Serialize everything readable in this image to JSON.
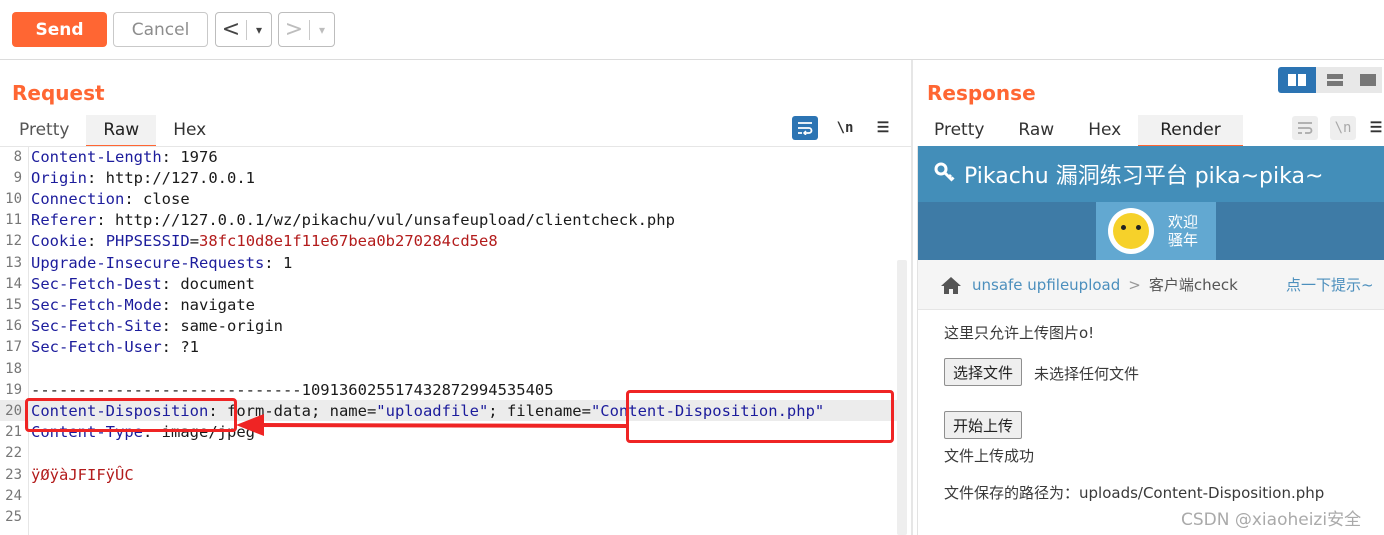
{
  "toolbar": {
    "send_label": "Send",
    "cancel_label": "Cancel",
    "back_arrow": "<",
    "forward_arrow": ">",
    "dropdown_glyph": "▾"
  },
  "request": {
    "title": "Request",
    "tabs": [
      "Pretty",
      "Raw",
      "Hex"
    ],
    "active_tab": "Raw",
    "tool_wrap_icon": "wrap-lines-icon",
    "tool_newline_label": "\\n",
    "tool_menu_glyph": "☰",
    "lines": [
      {
        "n": "8",
        "key": "Content-Length",
        "val": " 1976"
      },
      {
        "n": "9",
        "key": "Origin",
        "val": " http://127.0.0.1"
      },
      {
        "n": "10",
        "key": "Connection",
        "val": " close"
      },
      {
        "n": "11",
        "key": "Referer",
        "val": " http://127.0.0.1/wz/pikachu/vul/unsafeupload/clientcheck.php"
      },
      {
        "n": "12",
        "key": "Cookie",
        "val": " ",
        "cookie_name": "PHPSESSID",
        "cookie_eq": "=",
        "cookie_val": "38fc10d8e1f11e67bea0b270284cd5e8"
      },
      {
        "n": "13",
        "key": "Upgrade-Insecure-Requests",
        "val": " 1"
      },
      {
        "n": "14",
        "key": "Sec-Fetch-Dest",
        "val": " document"
      },
      {
        "n": "15",
        "key": "Sec-Fetch-Mode",
        "val": " navigate"
      },
      {
        "n": "16",
        "key": "Sec-Fetch-Site",
        "val": " same-origin"
      },
      {
        "n": "17",
        "key": "Sec-Fetch-User",
        "val": " ?1"
      },
      {
        "n": "18",
        "key": "",
        "val": ""
      },
      {
        "n": "19",
        "key": "",
        "val": "-----------------------------109136025517432872994535405"
      },
      {
        "n": "20",
        "key": "Content-Disposition",
        "val": " form-data; name=",
        "q1": "\"uploadfile\"",
        "mid": "; filename=",
        "q2": "\"Content-Disposition.php\""
      },
      {
        "n": "21",
        "key": "Content-Type",
        "val": " image/jpeg"
      },
      {
        "n": "22",
        "key": "",
        "val": ""
      },
      {
        "n": "23",
        "key": "",
        "val": "",
        "binary": "ÿØÿàJFIFÿÛC"
      },
      {
        "n": "24",
        "key": "",
        "val": ""
      },
      {
        "n": "25",
        "key": "",
        "val": ""
      }
    ],
    "key_color": "#1c1c9c",
    "value_red": "#b31c1c"
  },
  "response": {
    "title": "Response",
    "tabs": [
      "Pretty",
      "Raw",
      "Hex",
      "Render"
    ],
    "active_tab": "Render",
    "tool_newline_label": "\\n",
    "tool_menu_glyph": "☰",
    "layout_icons": [
      "split-horizontal-icon",
      "split-vertical-icon",
      "single-pane-icon"
    ]
  },
  "render": {
    "site_title": "Pikachu 漏洞练习平台 pika~pika~",
    "welcome_line1": "欢迎",
    "welcome_line2": "骚年",
    "breadcrumb_link": "unsafe upfileupload",
    "breadcrumb_sep": ">",
    "breadcrumb_current": "客户端check",
    "hint_link": "点一下提示~",
    "notice": "这里只允许上传图片o!",
    "choose_file_button": "选择文件",
    "no_file_text": "未选择任何文件",
    "upload_button": "开始上传",
    "success_text": "文件上传成功",
    "saved_path_text": "文件保存的路径为：uploads/Content-Disposition.php",
    "header_color": "#438eb9"
  },
  "watermark": "CSDN @xiaoheizi安全",
  "accent_color": "#ff6633",
  "annotation_color": "#ef2424"
}
